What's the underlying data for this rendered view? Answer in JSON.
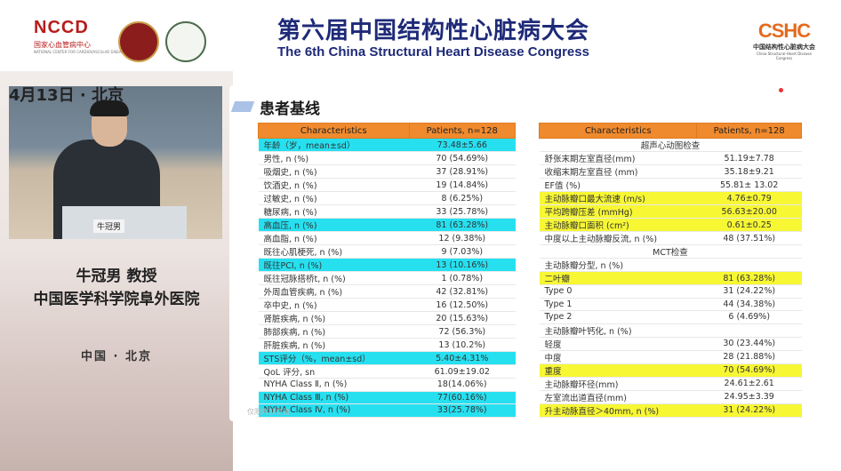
{
  "header": {
    "nccd_logo": "NCCD",
    "nccd_sub_cn": "国家心血管病中心",
    "nccd_sub_en": "NATIONAL CENTER FOR CARDIOVASCULAR DISEASES",
    "title_cn": "第六届中国结构性心脏病大会",
    "title_en": "The 6th China Structural Heart Disease Congress",
    "cshc_mark": "CSHC",
    "cshc_cn": "中国结构性心脏病大会",
    "cshc_en": "China Structural Heart Disease Congress"
  },
  "speaker": {
    "video_date": "4月13日 · 北京",
    "name_card": "牛冠男",
    "name_title": "牛冠男 教授",
    "organization": "中国医学科学院阜外医院",
    "location": "中国 · 北京"
  },
  "slide": {
    "title": "患者基线",
    "watermark": "仅限内部交流",
    "table_left": {
      "headers": [
        "Characteristics",
        "Patients, n=128"
      ],
      "rows": [
        {
          "label": "年龄（岁，mean±sd）",
          "value": "73.48±5.66",
          "hl": "c"
        },
        {
          "label": "男性, n (%)",
          "value": "70 (54.69%)",
          "hl": ""
        },
        {
          "label": "吸烟史, n (%)",
          "value": "37 (28.91%)",
          "hl": ""
        },
        {
          "label": "饮酒史, n (%)",
          "value": "19 (14.84%)",
          "hl": ""
        },
        {
          "label": "过敏史, n (%)",
          "value": "8 (6.25%)",
          "hl": ""
        },
        {
          "label": "糖尿病, n (%)",
          "value": "33 (25.78%)",
          "hl": ""
        },
        {
          "label": "高血压, n (%)",
          "value": "81 (63.28%)",
          "hl": "c"
        },
        {
          "label": "高血脂, n (%)",
          "value": "12 (9.38%)",
          "hl": ""
        },
        {
          "label": "既往心肌梗死, n (%)",
          "value": "9 (7.03%)",
          "hl": ""
        },
        {
          "label": "既往PCI, n (%)",
          "value": "13 (10.16%)",
          "hl": "c"
        },
        {
          "label": "既往冠脉搭桥t, n (%)",
          "value": "1 (0.78%)",
          "hl": ""
        },
        {
          "label": "外周血管疾病, n (%)",
          "value": "42 (32.81%)",
          "hl": ""
        },
        {
          "label": "卒中史, n (%)",
          "value": "16 (12.50%)",
          "hl": ""
        },
        {
          "label": "肾脏疾病, n (%)",
          "value": "20 (15.63%)",
          "hl": ""
        },
        {
          "label": "肺部疾病, n (%)",
          "value": "72 (56.3%)",
          "hl": ""
        },
        {
          "label": "肝脏疾病, n (%)",
          "value": "13 (10.2%)",
          "hl": ""
        },
        {
          "label": "STS评分（%，mean±sd）",
          "value": "5.40±4.31%",
          "hl": "c"
        },
        {
          "label": "QoL 评分, sn",
          "value": "61.09±19.02",
          "hl": ""
        },
        {
          "label": "NYHA Class Ⅱ, n (%)",
          "value": "18(14.06%)",
          "hl": ""
        },
        {
          "label": "NYHA Class Ⅲ, n (%)",
          "value": "77(60.16%)",
          "hl": "c"
        },
        {
          "label": "NYHA Class Ⅳ, n (%)",
          "value": "33(25.78%)",
          "hl": "c"
        }
      ]
    },
    "table_right": {
      "headers": [
        "Characteristics",
        "Patients, n=128"
      ],
      "rows": [
        {
          "label": "超声心动图检查",
          "value": "",
          "hl": "",
          "section": true
        },
        {
          "label": "舒张末期左室直径(mm)",
          "value": "51.19±7.78",
          "hl": ""
        },
        {
          "label": "收缩末期左室直径 (mm)",
          "value": "35.18±9.21",
          "hl": ""
        },
        {
          "label": "EF值 (%)",
          "value": "55.81± 13.02",
          "hl": ""
        },
        {
          "label": "主动脉瓣口最大流速 (m/s)",
          "value": "4.76±0.79",
          "hl": "y"
        },
        {
          "label": "平均跨瓣压差 (mmHg)",
          "value": "56.63±20.00",
          "hl": "y"
        },
        {
          "label": "主动脉瓣口面积 (cm²)",
          "value": "0.61±0.25",
          "hl": "y"
        },
        {
          "label": "中度以上主动脉瓣反流, n (%)",
          "value": "48 (37.51%)",
          "hl": ""
        },
        {
          "label": "MCT检查",
          "value": "",
          "hl": "",
          "section": true
        },
        {
          "label": "主动脉瓣分型, n (%)",
          "value": "",
          "hl": ""
        },
        {
          "label": "二叶瓣",
          "value": "81 (63.28%)",
          "hl": "y"
        },
        {
          "label": "Type 0",
          "value": "31 (24.22%)",
          "hl": ""
        },
        {
          "label": "Type 1",
          "value": "44 (34.38%)",
          "hl": ""
        },
        {
          "label": "Type 2",
          "value": "6 (4.69%)",
          "hl": ""
        },
        {
          "label": "主动脉瓣叶钙化, n (%)",
          "value": "",
          "hl": ""
        },
        {
          "label": "轻度",
          "value": "30 (23.44%)",
          "hl": ""
        },
        {
          "label": "中度",
          "value": "28 (21.88%)",
          "hl": ""
        },
        {
          "label": "重度",
          "value": "70 (54.69%)",
          "hl": "y"
        },
        {
          "label": "主动脉瓣环径(mm)",
          "value": "24.61±2.61",
          "hl": ""
        },
        {
          "label": "左室流出道直径(mm)",
          "value": "24.95±3.39",
          "hl": ""
        },
        {
          "label": "升主动脉直径＞40mm, n (%)",
          "value": "31 (24.22%)",
          "hl": "y"
        }
      ]
    }
  }
}
